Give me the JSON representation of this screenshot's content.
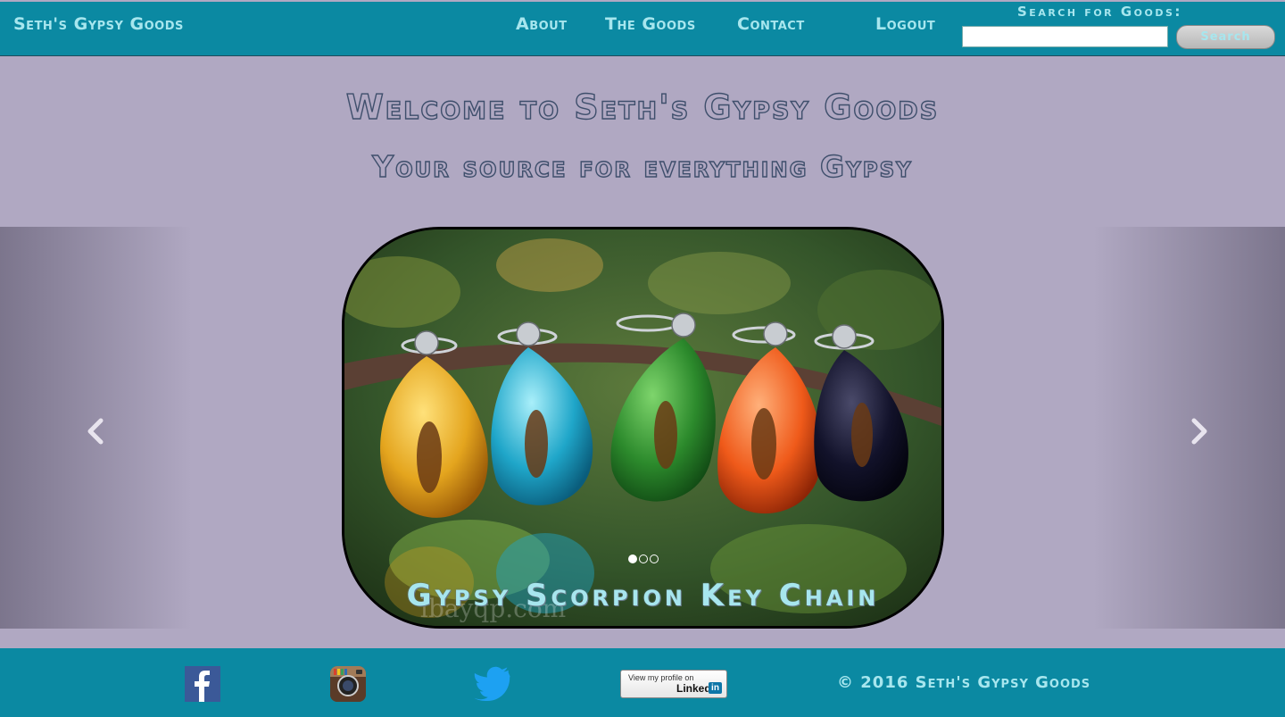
{
  "nav": {
    "brand": "Seth's Gypsy Goods",
    "links": [
      "About",
      "The Goods",
      "Contact"
    ],
    "logout": "Logout",
    "search_label": "Search for Goods:",
    "search_value": "",
    "search_button": "Search"
  },
  "hero": {
    "title": "Welcome to Seth's Gypsy Goods",
    "tagline": "Your source for everything Gypsy"
  },
  "carousel": {
    "caption": "Gypsy Scorpion Key Chain",
    "watermark": "lbayqp.com",
    "slide_count": 3,
    "active_index": 0
  },
  "footer": {
    "social": [
      "facebook-icon",
      "instagram-icon",
      "twitter-icon"
    ],
    "linkedin_top": "View my profile on",
    "linkedin_bottom": "Linked",
    "linkedin_in": "in",
    "copyright": "© 2016 Seth's Gypsy Goods"
  },
  "colors": {
    "nav_bg": "#0b89a2",
    "page_bg": "#b0a8c2",
    "accent_text": "#a7e6ee",
    "heading_stroke": "#3f4f6c"
  }
}
